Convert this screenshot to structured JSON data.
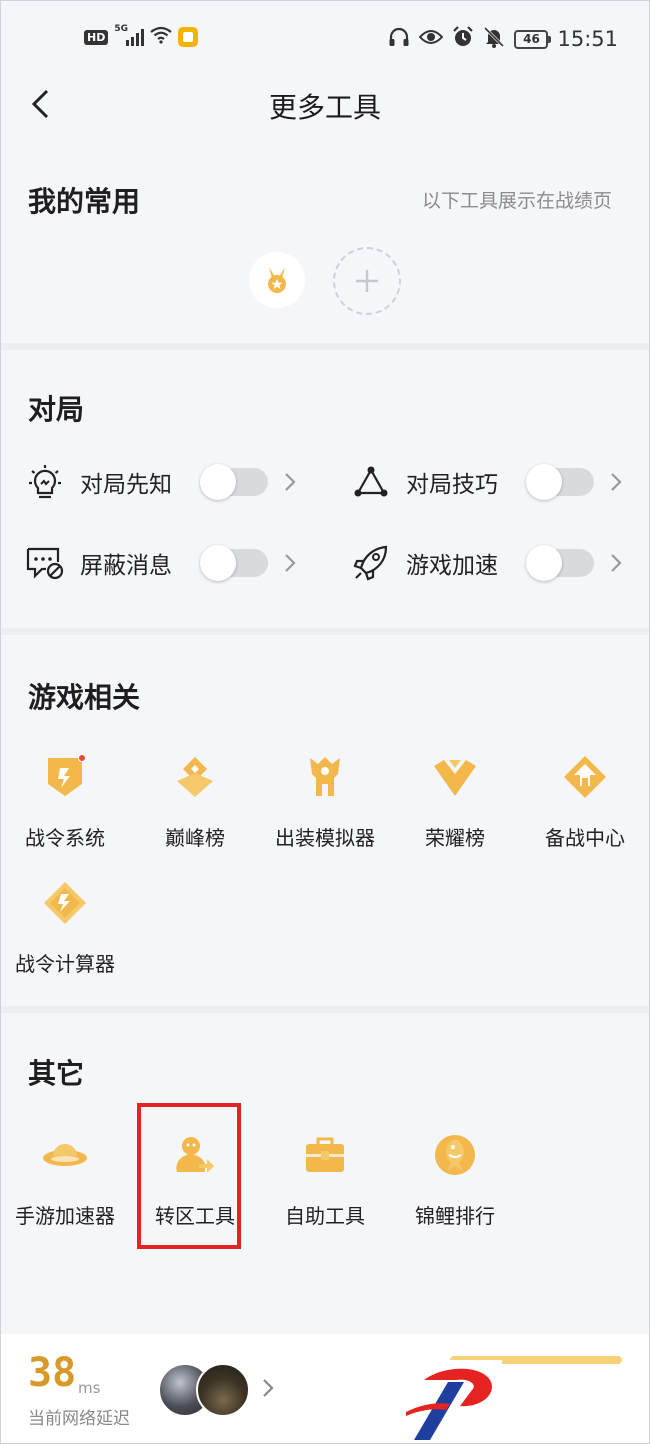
{
  "status_bar": {
    "hd": "HD",
    "network": "5G",
    "battery": "46",
    "time": "15:51",
    "icons": [
      "hd-icon",
      "signal-icon",
      "wifi-icon",
      "app-notification-icon",
      "headphones-icon",
      "eye-icon",
      "alarm-icon",
      "mute-icon",
      "battery-icon"
    ]
  },
  "nav": {
    "title": "更多工具",
    "back_icon": "back-arrow-icon"
  },
  "favorites": {
    "title": "我的常用",
    "note": "以下工具展示在战绩页",
    "items": [
      {
        "icon": "medal-icon"
      }
    ],
    "add_icon": "plus-icon"
  },
  "match": {
    "title": "对局",
    "toggles": [
      {
        "label": "对局先知",
        "icon": "lightbulb-icon",
        "on": false
      },
      {
        "label": "对局技巧",
        "icon": "triangle-nodes-icon",
        "on": false
      },
      {
        "label": "屏蔽消息",
        "icon": "message-block-icon",
        "on": false
      },
      {
        "label": "游戏加速",
        "icon": "rocket-icon",
        "on": false
      }
    ]
  },
  "game": {
    "title": "游戏相关",
    "items": [
      {
        "label": "战令系统",
        "icon": "battle-pass-icon",
        "badge": true
      },
      {
        "label": "巅峰榜",
        "icon": "peak-rank-icon"
      },
      {
        "label": "出装模拟器",
        "icon": "gear-simulator-icon"
      },
      {
        "label": "荣耀榜",
        "icon": "glory-rank-icon"
      },
      {
        "label": "备战中心",
        "icon": "prep-center-icon"
      },
      {
        "label": "战令计算器",
        "icon": "battle-pass-calculator-icon"
      }
    ]
  },
  "other": {
    "title": "其它",
    "items": [
      {
        "label": "手游加速器",
        "icon": "ufo-accelerator-icon"
      },
      {
        "label": "转区工具",
        "icon": "transfer-user-icon"
      },
      {
        "label": "自助工具",
        "icon": "toolbox-icon"
      },
      {
        "label": "锦鲤排行",
        "icon": "koi-fish-icon"
      }
    ]
  },
  "bottom": {
    "latency": "38",
    "unit": "ms",
    "label": "当前网络延迟"
  },
  "colors": {
    "accent_gold": "#f2b84b",
    "latency_gold": "#d79a2a",
    "highlight_red": "#e52320",
    "background": "#f5f6fa"
  }
}
